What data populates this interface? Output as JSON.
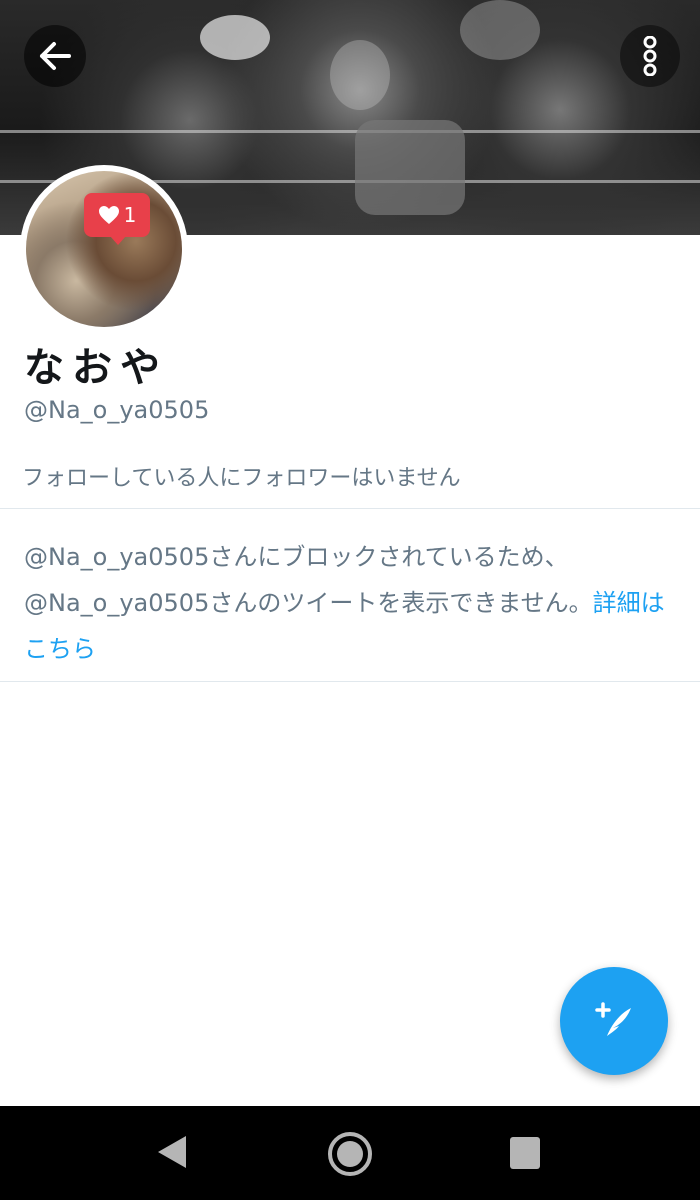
{
  "profile": {
    "display_name": "なおや",
    "handle": "@Na_o_ya0505",
    "follow_info": "フォローしている人にフォロワーはいません",
    "avatar_badge_count": "1"
  },
  "blocked": {
    "line1": "@Na_o_ya0505さんにブロックされているため、",
    "line2": "@Na_o_ya0505さんのツイートを表示できません。",
    "link_text": "詳細はこちら"
  },
  "icons": {
    "back": "arrow-left-icon",
    "menu": "more-vertical-icon",
    "compose": "compose-tweet-icon",
    "heart": "heart-icon"
  },
  "colors": {
    "accent": "#1da1f2",
    "text_primary": "#14171a",
    "text_secondary": "#657786",
    "badge": "#e8404a"
  }
}
